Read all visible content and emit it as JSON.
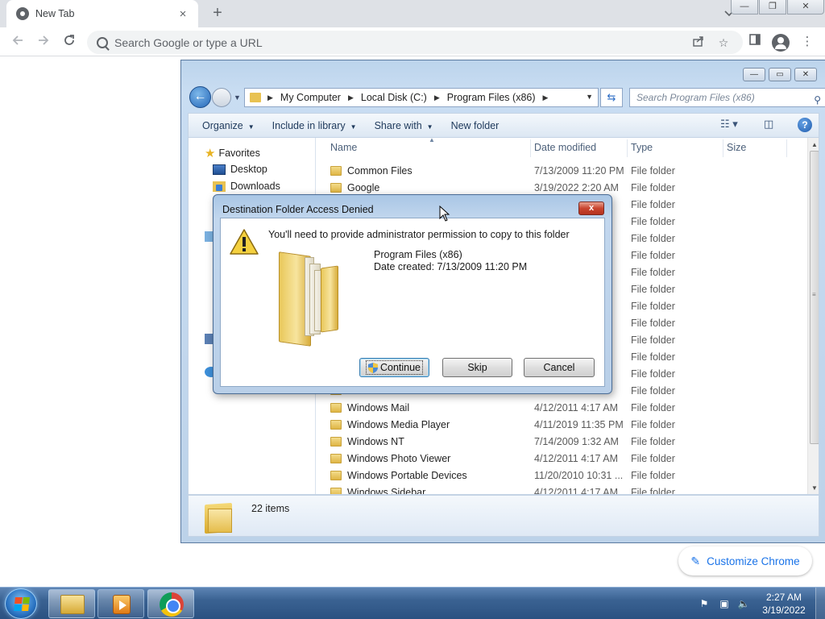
{
  "browser": {
    "tab_title": "New Tab",
    "tab_close": "×",
    "new_tab": "+",
    "omnibox_placeholder": "Search Google or type a URL",
    "customize_label": "Customize Chrome"
  },
  "explorer": {
    "breadcrumbs": [
      "My Computer",
      "Local Disk (C:)",
      "Program Files (x86)"
    ],
    "search_placeholder": "Search Program Files (x86)",
    "commands": [
      "Organize",
      "Include in library",
      "Share with",
      "New folder"
    ],
    "nav": {
      "favorites": "Favorites",
      "desktop": "Desktop",
      "downloads": "Downloads"
    },
    "columns": [
      "Name",
      "Date modified",
      "Type",
      "Size"
    ],
    "rows": [
      {
        "name": "Common Files",
        "date": "7/13/2009 11:20 PM",
        "type": "File folder"
      },
      {
        "name": "Google",
        "date": "3/19/2022 2:20 AM",
        "type": "File folder"
      },
      {
        "name": "",
        "date": "M",
        "type": "File folder"
      },
      {
        "name": "",
        "date": "M",
        "type": "File folder"
      },
      {
        "name": "",
        "date": "M",
        "type": "File folder"
      },
      {
        "name": "",
        "date": "M",
        "type": "File folder"
      },
      {
        "name": "",
        "date": "M",
        "type": "File folder"
      },
      {
        "name": "",
        "date": "M",
        "type": "File folder"
      },
      {
        "name": "",
        "date": "M",
        "type": "File folder"
      },
      {
        "name": "",
        "date": "M",
        "type": "File folder"
      },
      {
        "name": "",
        "date": "M",
        "type": "File folder"
      },
      {
        "name": "",
        "date": "AM",
        "type": "File folder"
      },
      {
        "name": "",
        "date": "M",
        "type": "File folder"
      },
      {
        "name": "",
        "date": "",
        "type": "File folder"
      },
      {
        "name": "Windows Mail",
        "date": "4/12/2011 4:17 AM",
        "type": "File folder"
      },
      {
        "name": "Windows Media Player",
        "date": "4/11/2019 11:35 PM",
        "type": "File folder"
      },
      {
        "name": "Windows NT",
        "date": "7/14/2009 1:32 AM",
        "type": "File folder"
      },
      {
        "name": "Windows Photo Viewer",
        "date": "4/12/2011 4:17 AM",
        "type": "File folder"
      },
      {
        "name": "Windows Portable Devices",
        "date": "11/20/2010 10:31 ...",
        "type": "File folder"
      },
      {
        "name": "Windows Sidebar",
        "date": "4/12/2011 4:17 AM",
        "type": "File folder"
      }
    ],
    "item_count": "22 items"
  },
  "dialog": {
    "title": "Destination Folder Access Denied",
    "close": "x",
    "message": "You'll need to provide administrator permission to copy to this folder",
    "folder_name": "Program Files (x86)",
    "date_created": "Date created: 7/13/2009 11:20 PM",
    "buttons": {
      "continue": "Continue",
      "skip": "Skip",
      "cancel": "Cancel"
    }
  },
  "taskbar": {
    "time": "2:27 AM",
    "date": "3/19/2022"
  },
  "icons": {
    "back": "arrow-left-icon",
    "forward": "arrow-right-icon",
    "reload": "reload-icon",
    "warning": "warning-icon",
    "shield": "uac-shield-icon"
  },
  "colors": {
    "chrome_accent": "#1a73e8",
    "explorer_frame": "#c9ddf2",
    "taskbar": "#3a6292",
    "dialog_close": "#c9452f"
  }
}
